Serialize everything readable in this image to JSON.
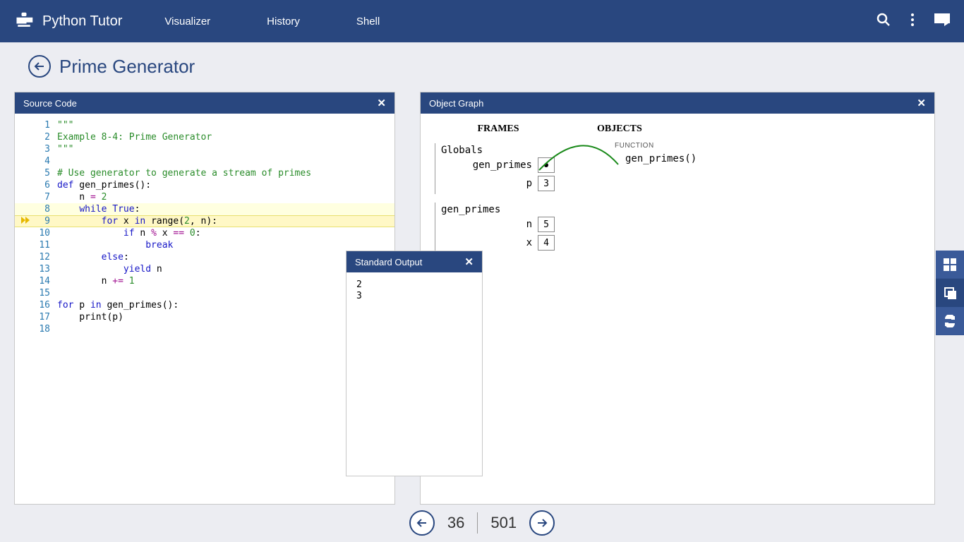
{
  "app": {
    "title": "Python Tutor"
  },
  "nav": {
    "visualizer": "Visualizer",
    "history": "History",
    "shell": "Shell"
  },
  "page": {
    "title": "Prime Generator"
  },
  "panels": {
    "source": {
      "title": "Source Code"
    },
    "objgraph": {
      "title": "Object Graph"
    },
    "stdout": {
      "title": "Standard Output"
    }
  },
  "code": {
    "lines": [
      {
        "n": 1,
        "raw": "\"\"\"",
        "cls": "str"
      },
      {
        "n": 2,
        "raw": "Example 8-4: Prime Generator",
        "cls": "str"
      },
      {
        "n": 3,
        "raw": "\"\"\"",
        "cls": "str"
      },
      {
        "n": 4,
        "raw": ""
      },
      {
        "n": 5,
        "raw": "# Use generator to generate a stream of primes",
        "cls": "com"
      },
      {
        "n": 6,
        "tokens": [
          [
            "kw",
            "def"
          ],
          [
            "",
            " gen_primes():"
          ]
        ]
      },
      {
        "n": 7,
        "tokens": [
          [
            "",
            "    n "
          ],
          [
            "op",
            "="
          ],
          [
            "",
            " "
          ],
          [
            "num",
            "2"
          ]
        ]
      },
      {
        "n": 8,
        "tokens": [
          [
            "",
            "    "
          ],
          [
            "kw",
            "while"
          ],
          [
            "",
            " "
          ],
          [
            "kw",
            "True"
          ],
          [
            "",
            ":"
          ]
        ],
        "hl": "prev"
      },
      {
        "n": 9,
        "tokens": [
          [
            "",
            "        "
          ],
          [
            "kw",
            "for"
          ],
          [
            "",
            " x "
          ],
          [
            "kw",
            "in"
          ],
          [
            "",
            " range("
          ],
          [
            "num",
            "2"
          ],
          [
            "",
            ", n):"
          ]
        ],
        "hl": "cur",
        "arrow": true
      },
      {
        "n": 10,
        "tokens": [
          [
            "",
            "            "
          ],
          [
            "kw",
            "if"
          ],
          [
            "",
            " n "
          ],
          [
            "op",
            "%"
          ],
          [
            "",
            " x "
          ],
          [
            "op",
            "=="
          ],
          [
            "",
            " "
          ],
          [
            "num",
            "0"
          ],
          [
            "",
            ":"
          ]
        ]
      },
      {
        "n": 11,
        "tokens": [
          [
            "",
            "                "
          ],
          [
            "kw",
            "break"
          ]
        ]
      },
      {
        "n": 12,
        "tokens": [
          [
            "",
            "        "
          ],
          [
            "kw",
            "else"
          ],
          [
            "",
            ":"
          ]
        ]
      },
      {
        "n": 13,
        "tokens": [
          [
            "",
            "            "
          ],
          [
            "kw",
            "yield"
          ],
          [
            "",
            " n"
          ]
        ]
      },
      {
        "n": 14,
        "tokens": [
          [
            "",
            "        n "
          ],
          [
            "op",
            "+="
          ],
          [
            "",
            " "
          ],
          [
            "num",
            "1"
          ]
        ]
      },
      {
        "n": 15,
        "raw": ""
      },
      {
        "n": 16,
        "tokens": [
          [
            "kw",
            "for"
          ],
          [
            "",
            " p "
          ],
          [
            "kw",
            "in"
          ],
          [
            "",
            " gen_primes():"
          ]
        ]
      },
      {
        "n": 17,
        "tokens": [
          [
            "",
            "    print(p)"
          ]
        ]
      },
      {
        "n": 18,
        "raw": ""
      }
    ]
  },
  "stdout": [
    "2",
    "3"
  ],
  "objgraph": {
    "frames_label": "FRAMES",
    "objects_label": "OBJECTS",
    "frames": [
      {
        "name": "Globals",
        "vars": [
          {
            "name": "gen_primes",
            "ptr": true
          },
          {
            "name": "p",
            "val": "3"
          }
        ]
      },
      {
        "name": "gen_primes",
        "vars": [
          {
            "name": "n",
            "val": "5"
          },
          {
            "name": "x",
            "val": "4"
          }
        ]
      }
    ],
    "objects": [
      {
        "type": "FUNCTION",
        "repr": "gen_primes()"
      }
    ]
  },
  "stepper": {
    "current": "36",
    "total": "501"
  }
}
